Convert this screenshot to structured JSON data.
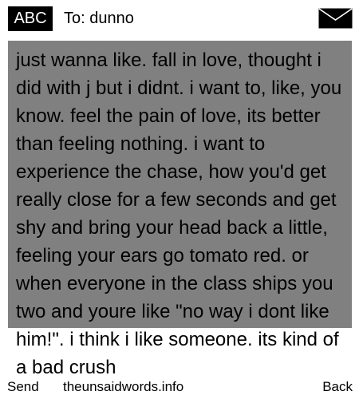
{
  "header": {
    "mode_label": "ABC",
    "recipient": "To: dunno",
    "icon": "envelope-icon"
  },
  "message": {
    "body": "just wanna like. fall in love, thought i did with j but i didnt. i want to, like, you know. feel the pain of love, its better than feeling nothing. i want to experience the chase, how you'd get really close for a few seconds and get shy and bring your head back a little, feeling your ears go tomato red. or when everyone in the class ships you two and youre like \"no way i dont like him!\". i think i like someone. its kind of a bad crush"
  },
  "softkeys": {
    "left": "Send",
    "center": "theunsaidwords.info",
    "right": "Back"
  },
  "colors": {
    "message_background": "#808080",
    "badge_background": "#000000",
    "page_background": "#ffffff"
  }
}
